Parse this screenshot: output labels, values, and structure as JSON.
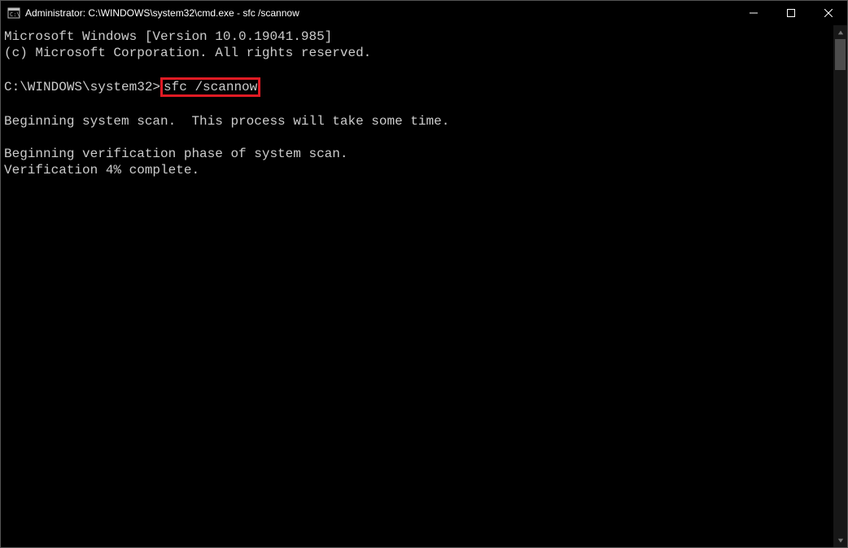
{
  "titlebar": {
    "text": "Administrator: C:\\WINDOWS\\system32\\cmd.exe - sfc  /scannow"
  },
  "terminal": {
    "line1": "Microsoft Windows [Version 10.0.19041.985]",
    "line2": "(c) Microsoft Corporation. All rights reserved.",
    "blank1": "",
    "prompt": "C:\\WINDOWS\\system32>",
    "command": "sfc /scannow",
    "blank2": "",
    "line3": "Beginning system scan.  This process will take some time.",
    "blank3": "",
    "line4": "Beginning verification phase of system scan.",
    "line5": "Verification 4% complete."
  },
  "highlight_color": "#e01b24"
}
